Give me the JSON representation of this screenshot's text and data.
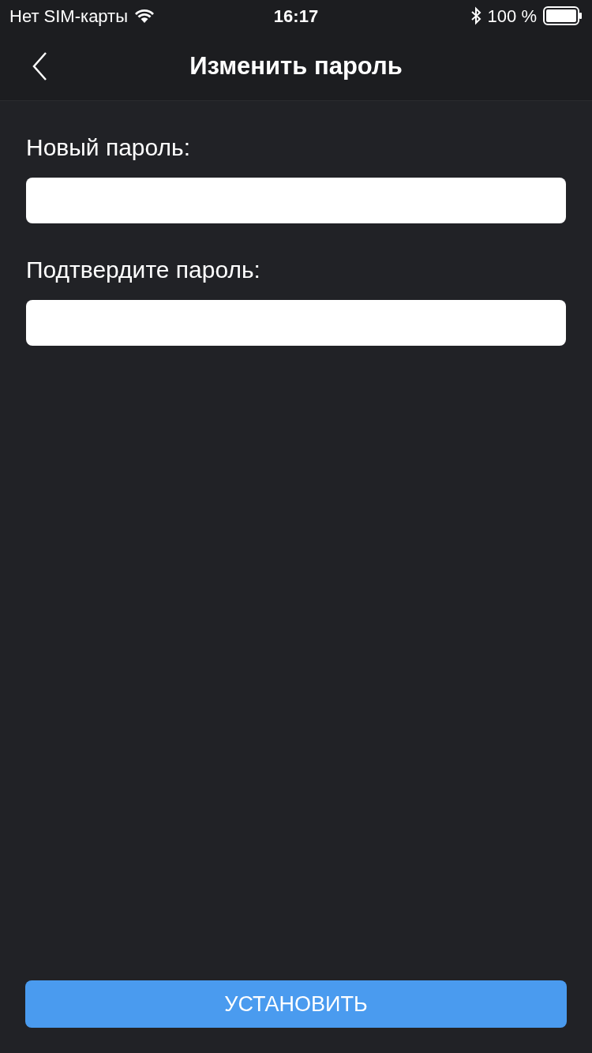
{
  "status_bar": {
    "carrier": "Нет SIM-карты",
    "time": "16:17",
    "battery": "100 %"
  },
  "nav_bar": {
    "title": "Изменить пароль"
  },
  "fields": [
    {
      "label": "Новый пароль:"
    },
    {
      "label": "Подтвердите пароль:"
    }
  ],
  "submit_button": {
    "label": "УСТАНОВИТЬ"
  }
}
